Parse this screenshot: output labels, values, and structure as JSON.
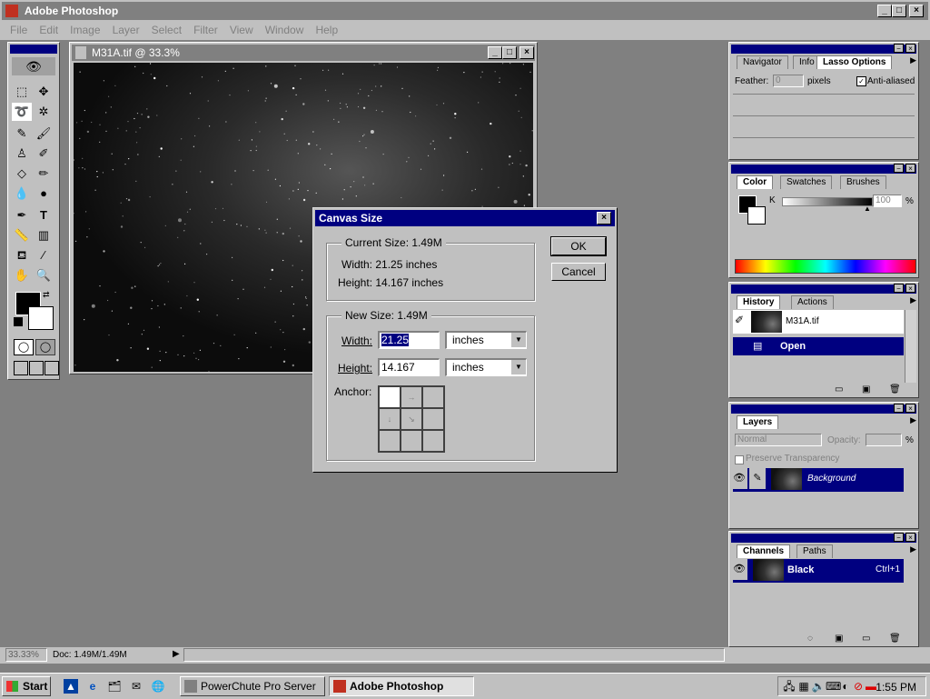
{
  "app": {
    "title": "Adobe Photoshop"
  },
  "menu": [
    "File",
    "Edit",
    "Image",
    "Layer",
    "Select",
    "Filter",
    "View",
    "Window",
    "Help"
  ],
  "document": {
    "title": "M31A.tif @ 33.3%"
  },
  "dialog": {
    "title": "Canvas Size",
    "current_size_label": "Current Size:  1.49M",
    "current_width": "Width:  21.25 inches",
    "current_height": "Height:  14.167 inches",
    "new_size_label": "New Size:  1.49M",
    "width_label": "Width:",
    "width_value": "21.25",
    "width_unit": "inches",
    "height_label": "Height:",
    "height_value": "14.167",
    "height_unit": "inches",
    "anchor_label": "Anchor:",
    "ok_label": "OK",
    "cancel_label": "Cancel"
  },
  "navigator_palette": {
    "tabs": [
      "Navigator",
      "Info",
      "Lasso Options"
    ],
    "feather_label": "Feather:",
    "feather_value": "0",
    "feather_unit": "pixels",
    "antialiased_label": "Anti-aliased"
  },
  "color_palette": {
    "tabs": [
      "Color",
      "Swatches",
      "Brushes"
    ],
    "channel_label": "K",
    "channel_value": "100",
    "percent": "%"
  },
  "history_palette": {
    "tabs": [
      "History",
      "Actions"
    ],
    "snapshot": "M31A.tif",
    "states": [
      "Open"
    ]
  },
  "layers_palette": {
    "tabs": [
      "Layers"
    ],
    "blend_mode": "Normal",
    "opacity_label": "Opacity:",
    "percent": "%",
    "preserve_label": "Preserve Transparency",
    "layers": [
      "Background"
    ]
  },
  "channels_palette": {
    "tabs": [
      "Channels",
      "Paths"
    ],
    "channels": [
      {
        "name": "Black",
        "shortcut": "Ctrl+1"
      }
    ]
  },
  "status": {
    "zoom": "33.33%",
    "doc": "Doc: 1.49M/1.49M"
  },
  "taskbar": {
    "start_label": "Start",
    "tasks": [
      "PowerChute Pro Server",
      "Adobe Photoshop"
    ],
    "clock": "1:55 PM"
  }
}
